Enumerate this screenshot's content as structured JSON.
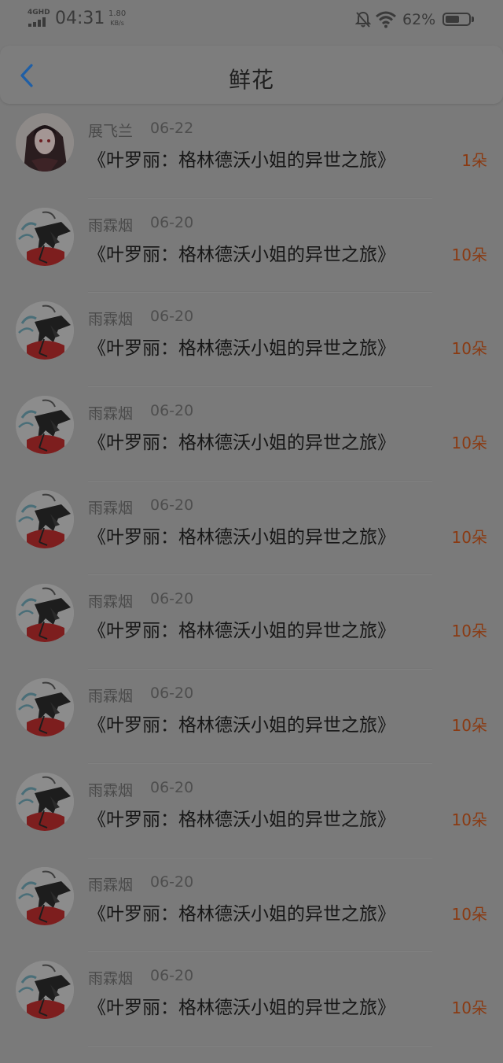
{
  "status_bar": {
    "network": "4GHD",
    "time": "04:31",
    "speed_value": "1.80",
    "speed_unit": "KB/s",
    "battery_percent": "62%",
    "battery_level": 0.62
  },
  "header": {
    "title": "鲜花",
    "back_icon": "chevron-left-icon",
    "accent_color": "#1f5fa6"
  },
  "flowers": [
    {
      "user": "展飞兰",
      "date": "06-22",
      "book": "《叶罗丽：格林德沃小姐的异世之旅》",
      "count": "1朵",
      "avatar": "girl"
    },
    {
      "user": "雨霖烟",
      "date": "06-20",
      "book": "《叶罗丽：格林德沃小姐的异世之旅》",
      "count": "10朵",
      "avatar": "ink"
    },
    {
      "user": "雨霖烟",
      "date": "06-20",
      "book": "《叶罗丽：格林德沃小姐的异世之旅》",
      "count": "10朵",
      "avatar": "ink"
    },
    {
      "user": "雨霖烟",
      "date": "06-20",
      "book": "《叶罗丽：格林德沃小姐的异世之旅》",
      "count": "10朵",
      "avatar": "ink"
    },
    {
      "user": "雨霖烟",
      "date": "06-20",
      "book": "《叶罗丽：格林德沃小姐的异世之旅》",
      "count": "10朵",
      "avatar": "ink"
    },
    {
      "user": "雨霖烟",
      "date": "06-20",
      "book": "《叶罗丽：格林德沃小姐的异世之旅》",
      "count": "10朵",
      "avatar": "ink"
    },
    {
      "user": "雨霖烟",
      "date": "06-20",
      "book": "《叶罗丽：格林德沃小姐的异世之旅》",
      "count": "10朵",
      "avatar": "ink"
    },
    {
      "user": "雨霖烟",
      "date": "06-20",
      "book": "《叶罗丽：格林德沃小姐的异世之旅》",
      "count": "10朵",
      "avatar": "ink"
    },
    {
      "user": "雨霖烟",
      "date": "06-20",
      "book": "《叶罗丽：格林德沃小姐的异世之旅》",
      "count": "10朵",
      "avatar": "ink"
    },
    {
      "user": "雨霖烟",
      "date": "06-20",
      "book": "《叶罗丽：格林德沃小姐的异世之旅》",
      "count": "10朵",
      "avatar": "ink"
    }
  ],
  "colors": {
    "count_text": "#8a3a12",
    "overlay_background": "#7a7a7a"
  }
}
